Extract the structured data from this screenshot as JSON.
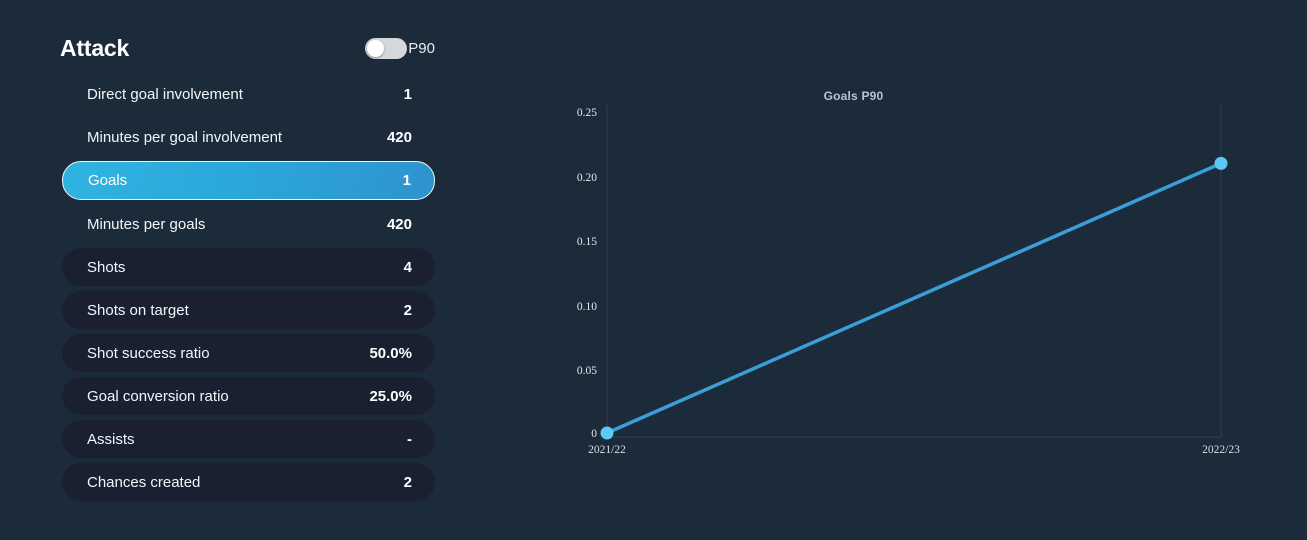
{
  "panel": {
    "title": "Attack",
    "toggle": {
      "label": "P90",
      "state": "off"
    },
    "stats": [
      {
        "label": "Direct goal involvement",
        "value": "1",
        "style": "plain",
        "selected": false
      },
      {
        "label": "Minutes per goal involvement",
        "value": "420",
        "style": "plain",
        "selected": false
      },
      {
        "label": "Goals",
        "value": "1",
        "style": "selected",
        "selected": true
      },
      {
        "label": "Minutes per goals",
        "value": "420",
        "style": "plain",
        "selected": false
      },
      {
        "label": "Shots",
        "value": "4",
        "style": "filled",
        "selected": false
      },
      {
        "label": "Shots on target",
        "value": "2",
        "style": "filled",
        "selected": false
      },
      {
        "label": "Shot success ratio",
        "value": "50.0%",
        "style": "filled",
        "selected": false
      },
      {
        "label": "Goal conversion ratio",
        "value": "25.0%",
        "style": "filled",
        "selected": false
      },
      {
        "label": "Assists",
        "value": "-",
        "style": "filled",
        "selected": false
      },
      {
        "label": "Chances created",
        "value": "2",
        "style": "filled",
        "selected": false
      }
    ]
  },
  "colors": {
    "background": "#1c2b39",
    "row_filled": "#1a2030",
    "accent": "#2ba8db",
    "line": "#3a9fd8",
    "marker": "#5bc8f5",
    "axis": "#2c3b4a",
    "text": "#f2f6fa"
  },
  "chart_data": {
    "type": "line",
    "title": "Goals P90",
    "xlabel": "",
    "ylabel": "",
    "x": [
      "2021/22",
      "2022/23"
    ],
    "categories": [
      "2021/22",
      "2022/23"
    ],
    "series": [
      {
        "name": "Goals P90",
        "values": [
          0,
          0.21
        ]
      }
    ],
    "ytick_labels": [
      "0.25",
      "0.20",
      "0.15",
      "0.10",
      "0.05",
      "0"
    ],
    "ytick_values": [
      0.25,
      0.2,
      0.15,
      0.1,
      0.05,
      0
    ],
    "ylim": [
      0,
      0.27
    ],
    "grid": false,
    "legend": "none",
    "markers": true
  }
}
